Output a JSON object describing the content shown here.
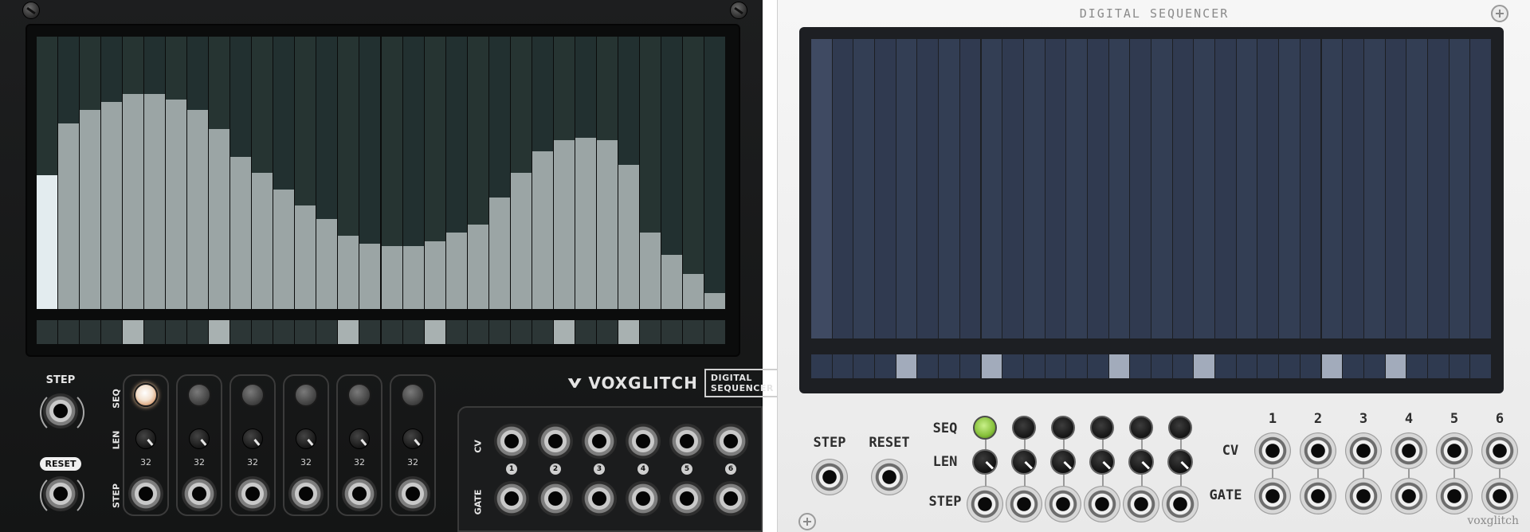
{
  "dark_module": {
    "brand_name": "VOXGLITCH",
    "brand_subtitle": "DIGITAL SEQUENCER",
    "step_label": "STEP",
    "reset_label": "RESET",
    "row_labels": {
      "seq": "SEQ",
      "len": "LEN",
      "step": "STEP",
      "cv": "CV",
      "gate": "GATE"
    },
    "sequencer_buttons": [
      true,
      false,
      false,
      false,
      false,
      false
    ],
    "lengths": [
      "32",
      "32",
      "32",
      "32",
      "32",
      "32"
    ],
    "output_numbers": [
      "1",
      "2",
      "3",
      "4",
      "5",
      "6"
    ],
    "steps": 32,
    "active_step": 0,
    "bar_levels": [
      0.49,
      0.68,
      0.73,
      0.76,
      0.79,
      0.79,
      0.77,
      0.73,
      0.66,
      0.56,
      0.5,
      0.44,
      0.38,
      0.33,
      0.27,
      0.24,
      0.23,
      0.23,
      0.25,
      0.28,
      0.31,
      0.41,
      0.5,
      0.58,
      0.62,
      0.63,
      0.62,
      0.53,
      0.28,
      0.2,
      0.13,
      0.06
    ],
    "gates": [
      false,
      false,
      false,
      false,
      true,
      false,
      false,
      false,
      true,
      false,
      false,
      false,
      false,
      false,
      true,
      false,
      false,
      false,
      true,
      false,
      false,
      false,
      false,
      false,
      true,
      false,
      false,
      true,
      false,
      false,
      false,
      false
    ]
  },
  "light_module": {
    "title": "DIGITAL SEQUENCER",
    "footer_brand": "voxglitch",
    "step_label": "STEP",
    "reset_label": "RESET",
    "row_labels": {
      "seq": "SEQ",
      "len": "LEN",
      "step": "STEP",
      "cv": "CV",
      "gate": "GATE"
    },
    "output_numbers": [
      "1",
      "2",
      "3",
      "4",
      "5",
      "6"
    ],
    "sequencer_buttons": [
      true,
      false,
      false,
      false,
      false,
      false
    ],
    "steps": 32,
    "gates": [
      false,
      false,
      false,
      false,
      true,
      false,
      false,
      false,
      true,
      false,
      false,
      false,
      false,
      false,
      true,
      false,
      false,
      false,
      true,
      false,
      false,
      false,
      false,
      false,
      true,
      false,
      false,
      true,
      false,
      false,
      false,
      false
    ]
  }
}
